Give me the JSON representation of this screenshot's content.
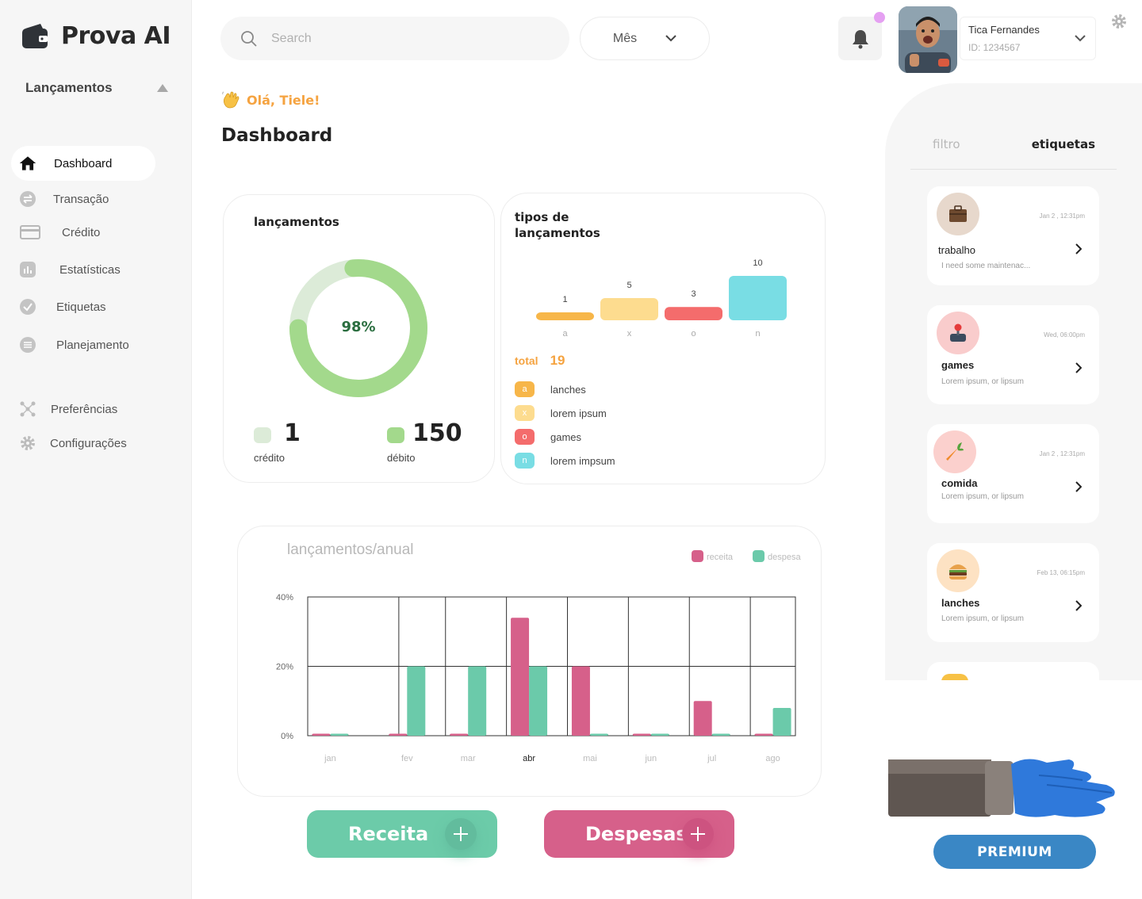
{
  "app": {
    "name": "Prova AI"
  },
  "sidebar": {
    "section_title": "Lançamentos",
    "items": [
      {
        "label": "Dashboard",
        "icon": "home-icon",
        "active": true
      },
      {
        "label": "Transação",
        "icon": "exchange-icon"
      },
      {
        "label": "Crédito",
        "icon": "credit-card-icon"
      },
      {
        "label": "Estatísticas",
        "icon": "stats-icon"
      },
      {
        "label": "Etiquetas",
        "icon": "tag-check-icon"
      },
      {
        "label": "Planejamento",
        "icon": "list-icon"
      }
    ],
    "bottom_items": [
      {
        "label": "Preferências",
        "icon": "network-icon"
      },
      {
        "label": "Configurações",
        "icon": "gear-icon"
      }
    ]
  },
  "topbar": {
    "search_placeholder": "Search",
    "month_label": "Mês",
    "user": {
      "name": "Tica Fernandes",
      "id": "ID: 1234567"
    }
  },
  "greeting": "Olá, Tiele!",
  "page_title": "Dashboard",
  "card_lancamentos": {
    "title": "lançamentos",
    "percent_label": "98%",
    "percent_value": 0.98,
    "credito_value": "1",
    "credito_label": "crédito",
    "debito_value": "150",
    "debito_label": "débito",
    "colors": {
      "light": "#dcebd8",
      "dark": "#a3d98c"
    }
  },
  "card_tipos": {
    "title_line1": "tipos de",
    "title_line2": "lançamentos",
    "total_label": "total",
    "total_value": "19",
    "legend": [
      {
        "letter": "a",
        "label": "lanches",
        "color": "#f7b649"
      },
      {
        "letter": "x",
        "label": "lorem ipsum",
        "color": "#fddc8f"
      },
      {
        "letter": "o",
        "label": "games",
        "color": "#f46c6c"
      },
      {
        "letter": "n",
        "label": "lorem impsum",
        "color": "#79dde4"
      }
    ]
  },
  "chart_data": [
    {
      "type": "bar",
      "categories": [
        "a",
        "x",
        "o",
        "n"
      ],
      "values": [
        1,
        5,
        3,
        10
      ],
      "colors": [
        "#f7b649",
        "#fddc8f",
        "#f46c6c",
        "#79dde4"
      ]
    },
    {
      "type": "bar",
      "title": "lançamentos/anual",
      "categories": [
        "jan",
        "fev",
        "mar",
        "abr",
        "mai",
        "jun",
        "jul",
        "ago"
      ],
      "y_ticks": [
        "40%",
        "20%",
        "0%"
      ],
      "ylim": [
        0,
        40
      ],
      "series": [
        {
          "name": "receita",
          "color": "#d6608a",
          "values": [
            0.5,
            0.3,
            0.5,
            34,
            20,
            0.5,
            10,
            0.5
          ]
        },
        {
          "name": "despesa",
          "color": "#6bcaaa",
          "values": [
            0.5,
            20,
            20,
            20,
            0.5,
            0.5,
            0.5,
            8
          ]
        }
      ],
      "grid": true,
      "legend_position": "top-right"
    }
  ],
  "right_panel": {
    "tabs": [
      "filtro",
      "etiquetas"
    ],
    "tags": [
      {
        "name": "trabalho",
        "date": "Jan 2 , 12:31pm",
        "desc": "I need some maintenac...",
        "icon": "briefcase-icon",
        "bg": "#e7d8cc"
      },
      {
        "name": "games",
        "date": "Wed, 06:00pm",
        "desc": "Lorem ipsum, or lipsum",
        "icon": "joystick-icon",
        "bg": "#f9cccc"
      },
      {
        "name": "comida",
        "date": "Jan 2 , 12:31pm",
        "desc": "Lorem ipsum, or lipsum",
        "icon": "carrot-icon",
        "bg": "#fbd0cd"
      },
      {
        "name": "lanches",
        "date": "Feb 13, 06:15pm",
        "desc": "Lorem ipsum, or lipsum",
        "icon": "burger-icon",
        "bg": "#fde2c3"
      }
    ]
  },
  "premium_label": "PREMIUM",
  "buttons": {
    "receita": "Receita",
    "despesas": "Despesas"
  }
}
